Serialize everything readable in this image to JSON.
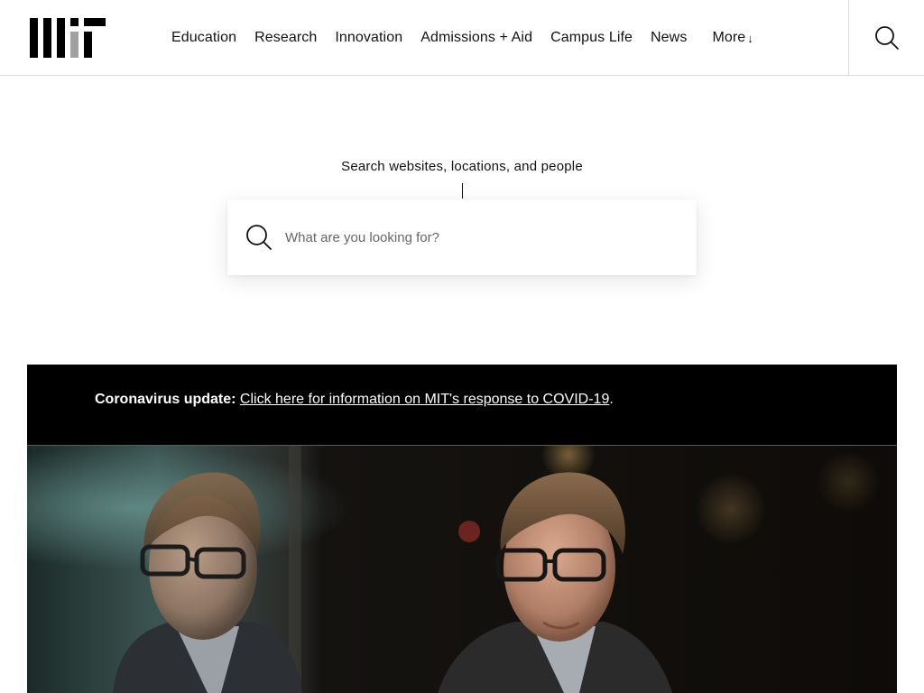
{
  "header": {
    "logo_alt": "MIT",
    "nav": [
      {
        "label": "Education"
      },
      {
        "label": "Research"
      },
      {
        "label": "Innovation"
      },
      {
        "label": "Admissions + Aid"
      },
      {
        "label": "Campus Life"
      },
      {
        "label": "News"
      }
    ],
    "more": {
      "label": "More",
      "arrow": "↓"
    },
    "search_icon": "search-icon"
  },
  "search": {
    "label": "Search websites, locations, and people",
    "placeholder": "What are you looking for?",
    "icon": "search-icon"
  },
  "alert": {
    "title": "Coronavirus update:",
    "link_text": "Click here for information on MIT's response to COVID-19",
    "trailing": "."
  },
  "colors": {
    "logo_accent": "#a1a1a1",
    "alert_bg": "#000000",
    "text": "#111111"
  }
}
